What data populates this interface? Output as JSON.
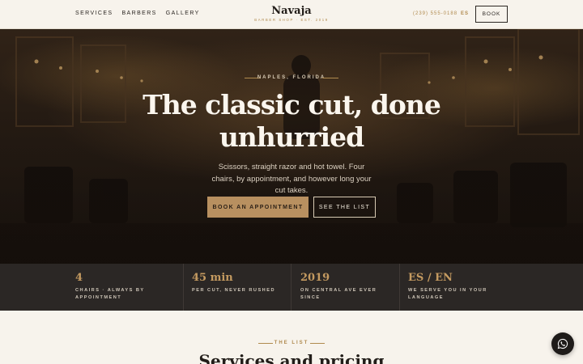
{
  "nav": [
    "Services",
    "Barbers",
    "Gallery"
  ],
  "brand": {
    "name": "Navaja",
    "tagline": "Barber shop · Est. 2019"
  },
  "header": {
    "phone": "(239) 555-0188",
    "lang": "ES",
    "book": "Book"
  },
  "hero": {
    "eyebrow": "Naples, Florida",
    "title": "The classic cut, done unhurried",
    "subtitle": "Scissors, straight razor and hot towel. Four chairs, by appointment, and however long your cut takes.",
    "cta_primary": "Book an appointment",
    "cta_secondary": "See the list"
  },
  "stats": [
    {
      "value": "4",
      "label": "Chairs · always by appointment"
    },
    {
      "value": "45 min",
      "label": "Per cut, never rushed"
    },
    {
      "value": "2019",
      "label": "On Central Ave ever since"
    },
    {
      "value": "ES / EN",
      "label": "We serve you in your language"
    }
  ],
  "list": {
    "eyebrow": "The list",
    "title": "Services and pricing"
  },
  "colors": {
    "accent": "#b08a4e",
    "dark": "#2b2725",
    "cream": "#f7f3ec"
  },
  "icons": {
    "floating": "whatsapp-icon"
  }
}
